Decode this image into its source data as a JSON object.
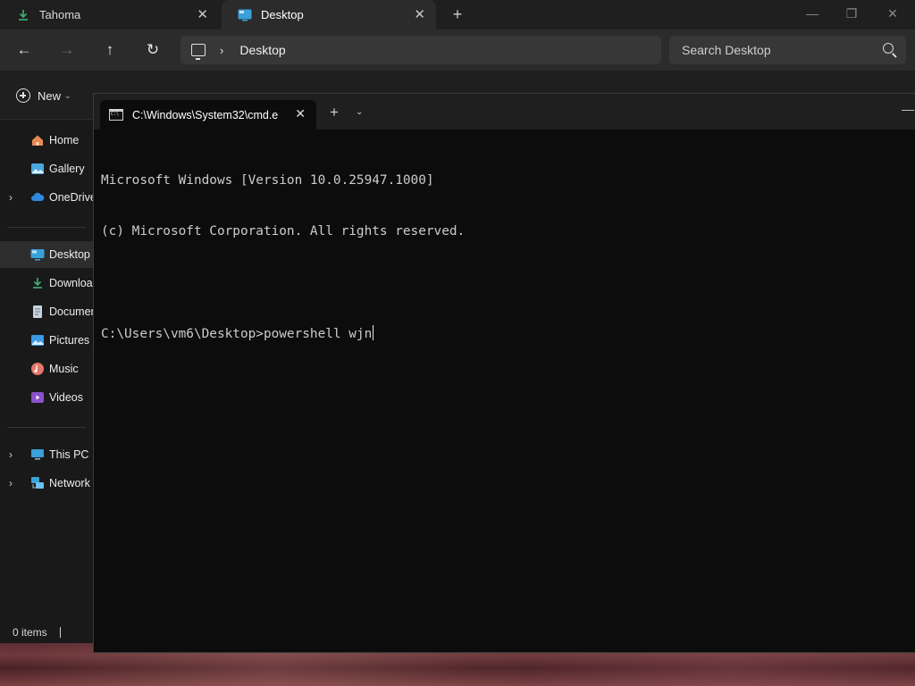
{
  "explorer": {
    "tabs": [
      {
        "label": "Tahoma",
        "icon": "download-icon",
        "active": false
      },
      {
        "label": "Desktop",
        "icon": "desktop-folder-icon",
        "active": true
      }
    ],
    "new_tab_symbol": "+",
    "window_controls": {
      "minimize": "—",
      "restore": "❐",
      "close": "✕"
    },
    "nav": {
      "back": "←",
      "forward": "→",
      "up": "↑",
      "refresh": "↻"
    },
    "address": {
      "chevron": "›",
      "location": "Desktop"
    },
    "search": {
      "placeholder": "Search Desktop"
    },
    "command_bar": {
      "new_label": "New",
      "caret": "⌄"
    },
    "sidebar": {
      "expand_symbol": "›",
      "items": [
        {
          "label": "Home",
          "icon": "home-icon",
          "expandable": false
        },
        {
          "label": "Gallery",
          "icon": "gallery-icon",
          "expandable": false
        },
        {
          "label": "OneDrive",
          "icon": "onedrive-cloud-icon",
          "expandable": true
        },
        {
          "label": "Desktop",
          "icon": "desktop-folder-icon",
          "expandable": false,
          "selected": true
        },
        {
          "label": "Downloads",
          "icon": "download-icon",
          "expandable": false
        },
        {
          "label": "Documents",
          "icon": "documents-icon",
          "expandable": false
        },
        {
          "label": "Pictures",
          "icon": "pictures-icon",
          "expandable": false
        },
        {
          "label": "Music",
          "icon": "music-icon",
          "expandable": false
        },
        {
          "label": "Videos",
          "icon": "videos-icon",
          "expandable": false
        },
        {
          "label": "This PC",
          "icon": "this-pc-icon",
          "expandable": true
        },
        {
          "label": "Network",
          "icon": "network-icon",
          "expandable": true
        }
      ]
    },
    "status": {
      "items_count": "0 items"
    }
  },
  "terminal": {
    "tab_title": "C:\\Windows\\System32\\cmd.e",
    "tab_close": "✕",
    "new_tab": "+",
    "dropdown": "⌄",
    "lines": [
      "Microsoft Windows [Version 10.0.25947.1000]",
      "(c) Microsoft Corporation. All rights reserved.",
      "",
      "C:\\Users\\vm6\\Desktop>powershell wjn"
    ]
  },
  "colors": {
    "explorer_bg": "#191919",
    "terminal_bg": "#0c0c0c",
    "terminal_text": "#cccccc",
    "accent_blue": "#4aa3df"
  }
}
